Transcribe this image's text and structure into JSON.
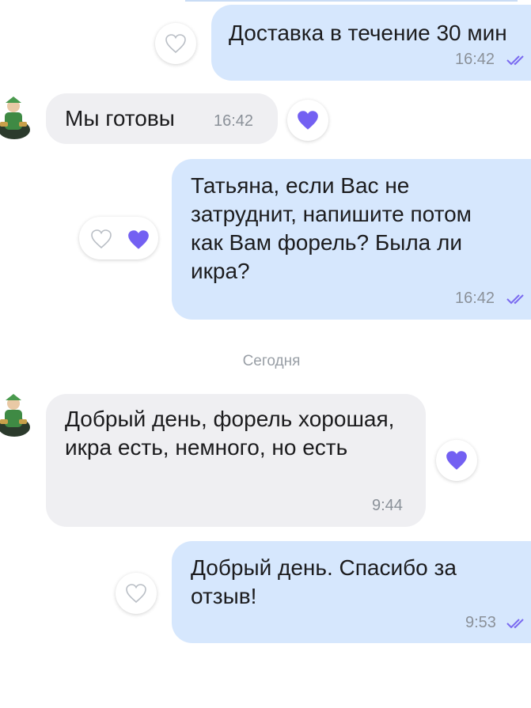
{
  "colors": {
    "outgoing_bubble": "#d6e7fd",
    "incoming_bubble": "#efeff2",
    "like_accent": "#7360f2",
    "timestamp": "#8b9199",
    "ticks": "#7a6af0"
  },
  "messages": [
    {
      "id": "m1",
      "direction": "outgoing",
      "text": "Доставка в течение 30 мин",
      "time": "16:42",
      "status": "double-check-icon",
      "liked_by_other": false
    },
    {
      "id": "m2",
      "direction": "incoming",
      "text": "Мы готовы",
      "time": "16:42",
      "liked": true,
      "avatar": "avatar-icon"
    },
    {
      "id": "m3",
      "direction": "outgoing",
      "text": "Татьяна, если Вас не затруднит, напишите потом как Вам форель? Была ли икра?",
      "time": "16:42",
      "status": "double-check-icon",
      "liked_by_other": true
    },
    {
      "id": "m4",
      "direction": "incoming",
      "text": "Добрый день, форель хорошая, икра есть, немного, но есть",
      "time": "9:44",
      "liked": true,
      "avatar": "avatar-icon"
    },
    {
      "id": "m5",
      "direction": "outgoing",
      "text": "Добрый день. Спасибо за отзыв!",
      "time": "9:53",
      "status": "double-check-icon",
      "liked_by_other": false
    }
  ],
  "date_separator": "Сегодня"
}
